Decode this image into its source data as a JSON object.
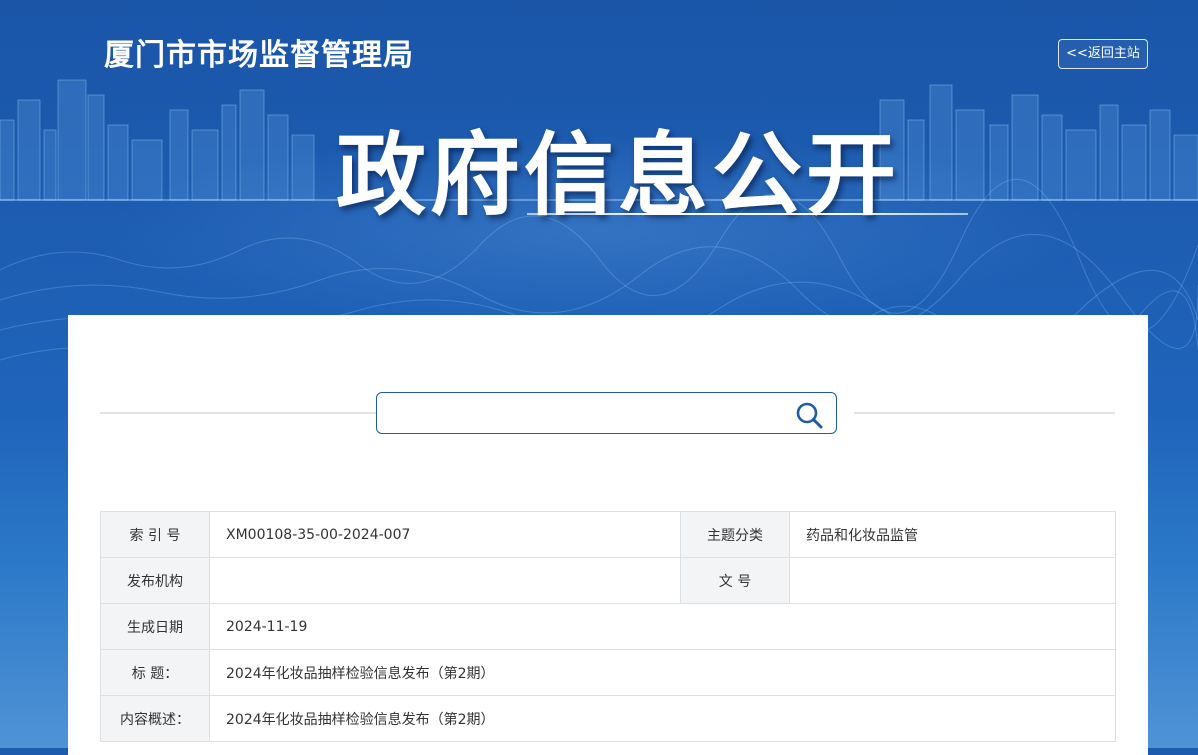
{
  "header": {
    "site_title": "厦门市市场监督管理局",
    "return_label": "<<返回主站",
    "hero_title": "政府信息公开"
  },
  "search": {
    "placeholder": "",
    "value": "",
    "icon": "search-icon"
  },
  "info_table": {
    "index_label": "索 引 号",
    "index_value": "XM00108-35-00-2024-007",
    "topic_label": "主题分类",
    "topic_value": "药品和化妆品监管",
    "publisher_label": "发布机构",
    "publisher_value": "",
    "doc_no_label": "文 号",
    "doc_no_value": "",
    "date_label": "生成日期",
    "date_value": "2024-11-19",
    "title_label": "标 题：",
    "title_value": "2024年化妆品抽样检验信息发布（第2期）",
    "summary_label": "内容概述：",
    "summary_value": "2024年化妆品抽样检验信息发布（第2期）"
  },
  "colors": {
    "primary": "#1c5bae",
    "search_border": "#1d5aa8",
    "label_bg": "#f3f4f6",
    "border": "#dcdfe3"
  }
}
